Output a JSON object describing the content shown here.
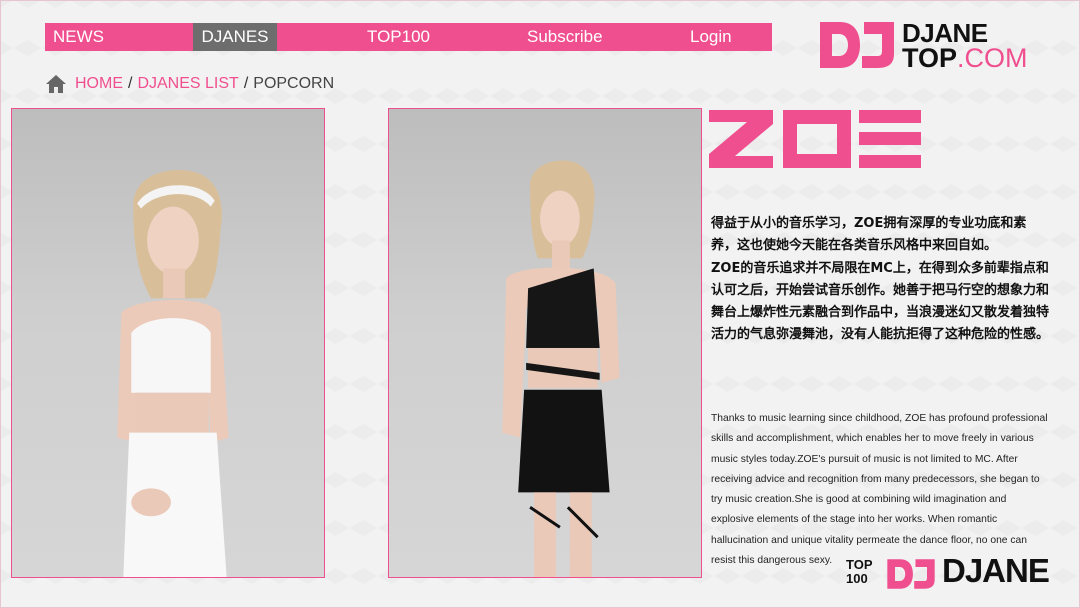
{
  "nav": {
    "items": [
      {
        "label": "NEWS"
      },
      {
        "label": "DJANES"
      },
      {
        "label": "TOP100"
      },
      {
        "label": "Subscribe"
      },
      {
        "label": "Login"
      }
    ],
    "active": "DJANES"
  },
  "logo": {
    "mark": "DJ",
    "line1": "DJANE",
    "line2_bold": "TOP",
    "line2_rest": ".COM"
  },
  "breadcrumb": {
    "home": "HOME",
    "list": "DJANES LIST",
    "current": "POPCORN",
    "separator": "/"
  },
  "artist": {
    "name": "ZOE",
    "bio_cn": [
      "得益于从小的音乐学习，ZOE拥有深厚的专业功底和素养，这也使她今天能在各类音乐风格中来回自如。",
      "ZOE的音乐追求并不局限在MC上，在得到众多前辈指点和认可之后，开始尝试音乐创作。她善于把马行空的想象力和舞台上爆炸性元素融合到作品中，当浪漫迷幻又散发着独特活力的气息弥漫舞池，没有人能抗拒得了这种危险的性感。"
    ],
    "bio_en": "Thanks to music learning since childhood, ZOE has profound professional skills and accomplishment, which enables her to move freely in various music styles today.ZOE's pursuit of music is not limited to MC. After receiving advice and recognition from many predecessors, she began to try music creation.She is good at combining wild imagination and explosive elements of the stage into her works. When romantic hallucination and unique vitality permeate the dance floor, no one can resist this dangerous sexy."
  },
  "footer_logo": {
    "top": "TOP",
    "hundred": "100",
    "mark": "DJ",
    "word": "DJANE"
  },
  "colors": {
    "accent": "#ef4f8f",
    "active_nav": "#6d6d6d",
    "text": "#111111"
  }
}
